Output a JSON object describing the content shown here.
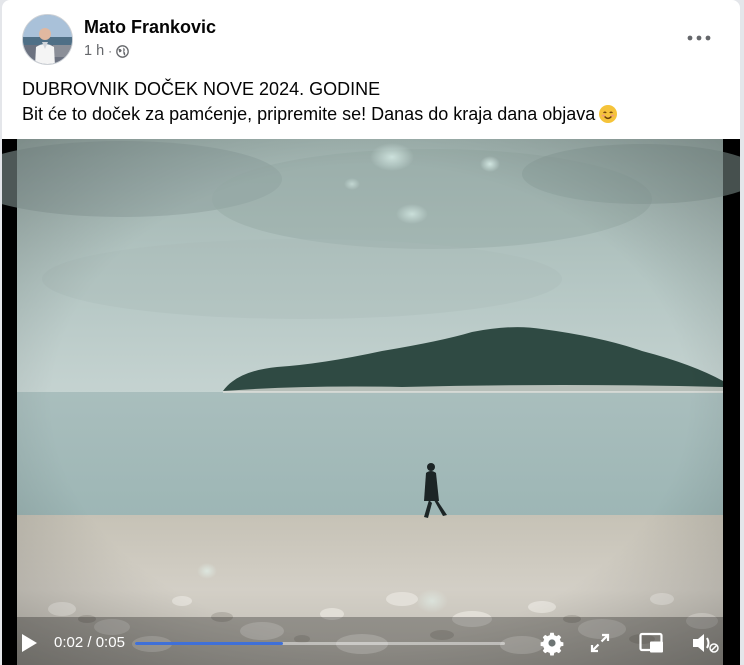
{
  "post": {
    "author": "Mato Frankovic",
    "time": "1 h",
    "separator": "·",
    "audience_icon": "globe-icon",
    "menu_icon": "more-horizontal-icon",
    "text_line1": "DUBROVNIK DOČEK NOVE 2024. GODINE",
    "text_line2": "Bit će to doček za pamćenje, pripremite se! Danas do kraja dana objava",
    "emoji": "smiling-face-icon"
  },
  "video": {
    "current_time": "0:02",
    "time_separator": "/",
    "duration": "0:05",
    "progress_fraction": 0.4,
    "seek_color": "#3f70d8",
    "controls": [
      "play-icon",
      "settings-icon",
      "fullscreen-icon",
      "picture-in-picture-icon",
      "mute-icon"
    ]
  }
}
